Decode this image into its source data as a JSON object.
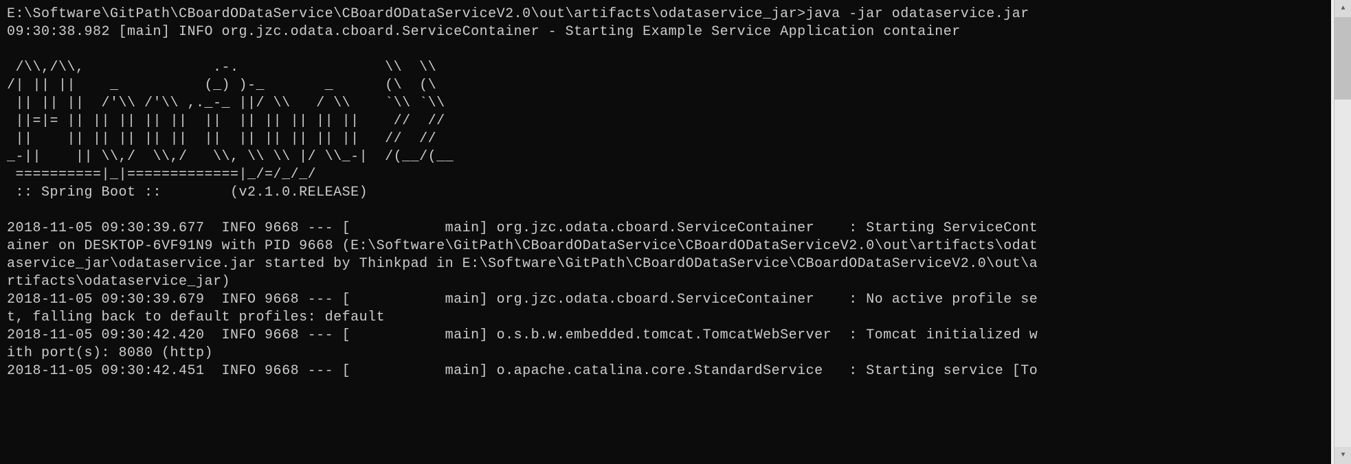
{
  "terminal": {
    "prompt_line": "E:\\Software\\GitPath\\CBoardODataService\\CBoardODataServiceV2.0\\out\\artifacts\\odataservice_jar>java -jar odataservice.jar",
    "first_log": "09:30:38.982 [main] INFO org.jzc.odata.cboard.ServiceContainer - Starting Example Service Application container",
    "blank": "",
    "ascii_line1": " /\\\\,/\\\\,               .-.                 \\\\  \\\\",
    "ascii_line2": "/| || ||    _          (_) )-_       _      (\\  (\\",
    "ascii_line3": " || || ||  /'\\\\ /'\\\\ ,._-_ ||/ \\\\   / \\\\    `\\\\ `\\\\",
    "ascii_line4": " ||=|= || || || || ||  ||  || || || || ||    //  //",
    "ascii_line5": " ||    || || || || ||  ||  || || || || ||   //  //",
    "ascii_line6": "_-||    || \\\\,/  \\\\,/   \\\\, \\\\ \\\\ |/ \\\\_-|  /(__/(__",
    "ascii_line7": " ==========|_|=============|_/=/_/_/",
    "spring_boot_line": " :: Spring Boot ::        (v2.1.0.RELEASE)",
    "blank2": "",
    "log1": "2018-11-05 09:30:39.677  INFO 9668 --- [           main] org.jzc.odata.cboard.ServiceContainer    : Starting ServiceCont",
    "log1b": "ainer on DESKTOP-6VF91N9 with PID 9668 (E:\\Software\\GitPath\\CBoardODataService\\CBoardODataServiceV2.0\\out\\artifacts\\odat",
    "log1c": "aservice_jar\\odataservice.jar started by Thinkpad in E:\\Software\\GitPath\\CBoardODataService\\CBoardODataServiceV2.0\\out\\a",
    "log1d": "rtifacts\\odataservice_jar)",
    "log2": "2018-11-05 09:30:39.679  INFO 9668 --- [           main] org.jzc.odata.cboard.ServiceContainer    : No active profile se",
    "log2b": "t, falling back to default profiles: default",
    "log3": "2018-11-05 09:30:42.420  INFO 9668 --- [           main] o.s.b.w.embedded.tomcat.TomcatWebServer  : Tomcat initialized w",
    "log3b": "ith port(s): 8080 (http)",
    "log4": "2018-11-05 09:30:42.451  INFO 9668 --- [           main] o.apache.catalina.core.StandardService   : Starting service [To"
  },
  "scrollbar": {
    "up_glyph": "▲",
    "down_glyph": "▼"
  }
}
